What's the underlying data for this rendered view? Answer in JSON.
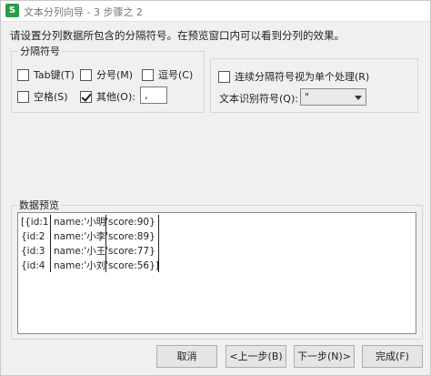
{
  "window": {
    "app_icon": "S",
    "title": "文本分列向导 - 3 步骤之 2"
  },
  "instruction": "请设置分列数据所包含的分隔符号。在预览窗口内可以看到分列的效果。",
  "delimiters": {
    "group_title": "分隔符号",
    "tab": {
      "label": "Tab键(T)",
      "checked": false
    },
    "semicolon": {
      "label": "分号(M)",
      "checked": false
    },
    "comma": {
      "label": "逗号(C)",
      "checked": false
    },
    "space": {
      "label": "空格(S)",
      "checked": false
    },
    "other": {
      "label": "其他(O):",
      "checked": true,
      "value": ","
    }
  },
  "options": {
    "consecutive": {
      "label": "连续分隔符号视为单个处理(R)",
      "checked": false
    },
    "text_qualifier_label": "文本识别符号(Q):",
    "text_qualifier_value": "\""
  },
  "preview": {
    "title": "数据预览",
    "rows": [
      [
        "[{id:1",
        "name:'小明'",
        "score:90}"
      ],
      [
        "{id:2",
        "name:'小李'",
        "score:89}"
      ],
      [
        "{id:3",
        "name:'小王'",
        "score:77}"
      ],
      [
        "{id:4",
        "name:'小刘'",
        "score:56}]"
      ]
    ]
  },
  "buttons": {
    "cancel": "取消",
    "back": "<上一步(B)",
    "next": "下一步(N)>",
    "finish": "完成(F)"
  }
}
